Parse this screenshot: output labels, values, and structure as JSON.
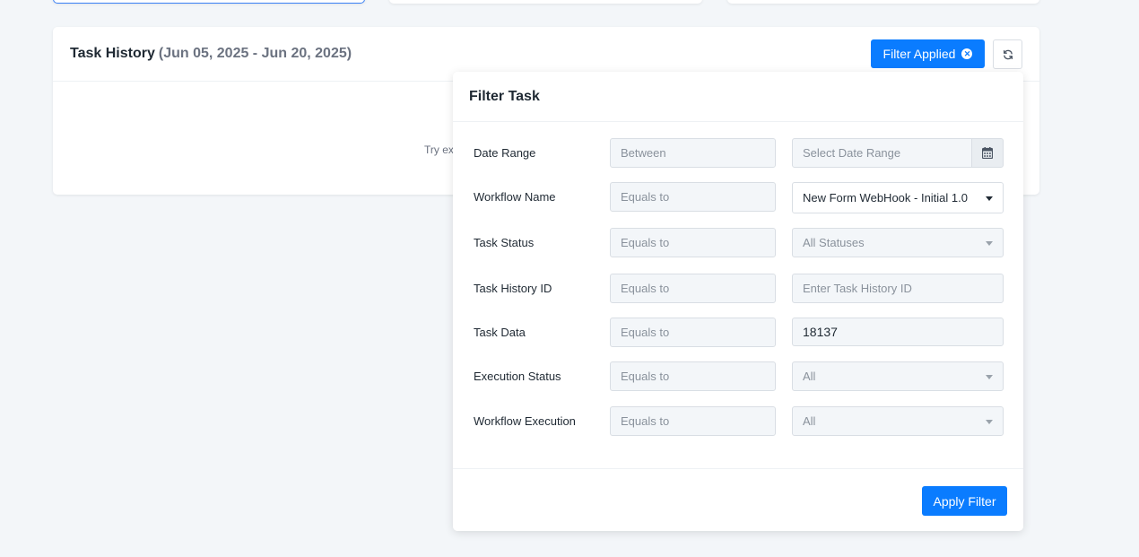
{
  "task_history": {
    "title": "Task History",
    "date_range": "(Jun 05, 2025 - Jun 20, 2025)",
    "filter_applied_label": "Filter Applied",
    "empty_hint": "Try ex"
  },
  "filter_panel": {
    "title": "Filter Task",
    "rows": [
      {
        "label": "Date Range",
        "operator": "Between",
        "value_placeholder": "Select Date Range"
      },
      {
        "label": "Workflow Name",
        "operator": "Equals to",
        "value": "New Form WebHook - Initial 1.0"
      },
      {
        "label": "Task Status",
        "operator": "Equals to",
        "value": "All Statuses"
      },
      {
        "label": "Task History ID",
        "operator": "Equals to",
        "value_placeholder": "Enter Task History ID"
      },
      {
        "label": "Task Data",
        "operator": "Equals to",
        "value": "18137"
      },
      {
        "label": "Execution Status",
        "operator": "Equals to",
        "value": "All"
      },
      {
        "label": "Workflow Execution",
        "operator": "Equals to",
        "value": "All"
      }
    ],
    "apply_label": "Apply Filter"
  },
  "colors": {
    "primary": "#0a7cff",
    "background": "#f3f6f9"
  },
  "icons": [
    "close-circle-icon",
    "refresh-icon",
    "calendar-icon",
    "chevron-down-icon"
  ]
}
